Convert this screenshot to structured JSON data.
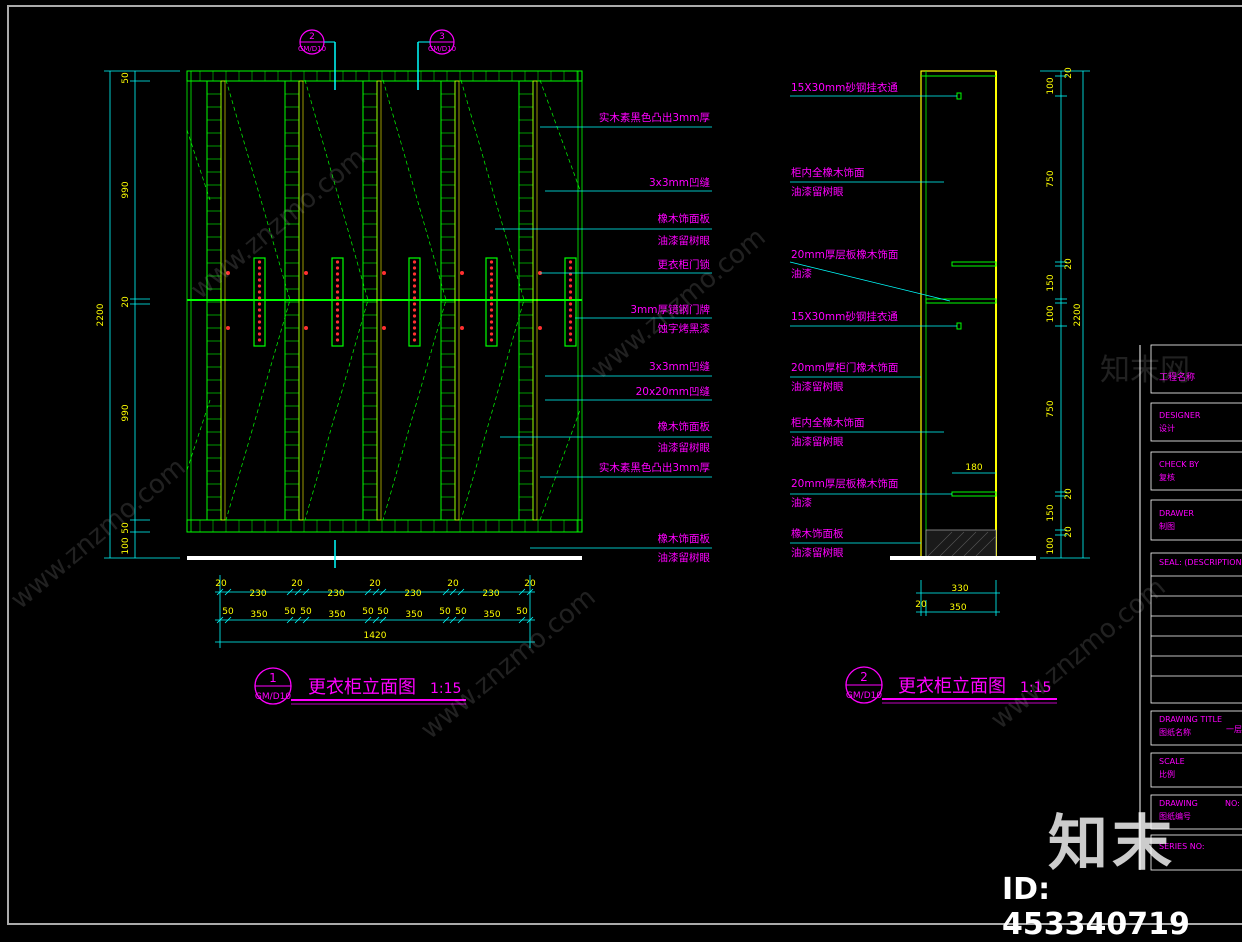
{
  "elevation_1": {
    "title": "更衣柜立面图",
    "scale": "1:15",
    "marker_num": "1",
    "marker_ref": "GM/D10",
    "section_markers": [
      {
        "num": "2",
        "ref": "GM/D10"
      },
      {
        "num": "3",
        "ref": "GM/D10"
      }
    ],
    "dims_left": [
      "50",
      "990",
      "20",
      "990",
      "50",
      "100"
    ],
    "dim_total": "2200",
    "dims_bottom_row1": [
      "20",
      "230",
      "20",
      "230",
      "20",
      "230",
      "20",
      "230",
      "20"
    ],
    "dims_bottom_row2": [
      "50",
      "350",
      "50",
      "50",
      "350",
      "50",
      "50",
      "350",
      "50",
      "50",
      "350",
      "50"
    ],
    "dim_width": "1420",
    "callouts": [
      [
        "实木素黑色凸出3mm厚"
      ],
      [
        "3x3mm凹缝"
      ],
      [
        "橡木饰面板",
        "油漆留树眼"
      ],
      [
        "更衣柜门锁"
      ],
      [
        "3mm厚镜钢门牌",
        "蚀字烤黑漆"
      ],
      [
        "3x3mm凹缝"
      ],
      [
        "20x20mm凹缝"
      ],
      [
        "橡木饰面板",
        "油漆留树眼"
      ],
      [
        "实木素黑色凸出3mm厚"
      ],
      [
        "橡木饰面板",
        "油漆留树眼"
      ]
    ]
  },
  "elevation_2": {
    "title": "更衣柜立面图",
    "scale": "1:15",
    "marker_num": "2",
    "marker_ref": "GM/D10",
    "callouts": [
      [
        "15X30mm砂钢挂衣通"
      ],
      [
        "柜内全橡木饰面",
        "油漆留树眼"
      ],
      [
        "20mm厚层板橡木饰面",
        "油漆"
      ],
      [
        "15X30mm砂钢挂衣通"
      ],
      [
        "20mm厚柜门橡木饰面",
        "油漆留树眼"
      ],
      [
        "柜内全橡木饰面",
        "油漆留树眼"
      ],
      [
        "20mm厚层板橡木饰面",
        "油漆"
      ],
      [
        "橡木饰面板",
        "油漆留树眼"
      ]
    ],
    "dim_shelf": "180",
    "dims_right": [
      "20",
      "100",
      "750",
      "20",
      "150",
      "100",
      "750",
      "20",
      "150",
      "20",
      "100"
    ],
    "dim_total": "2200",
    "dim_depth_1": "330",
    "dim_depth_2a": "20",
    "dim_depth_2b": "350"
  },
  "title_block": {
    "project": "工程名称",
    "designer_en": "DESIGNER",
    "designer_cn": "设计",
    "check_en": "CHECK BY",
    "check_cn": "复核",
    "drawer_en": "DRAWER",
    "drawer_cn": "制图",
    "seal": "SEAL: (DESCRIPTION)",
    "drawing_title_en": "DRAWING TITLE",
    "drawing_title_cn": "图纸名称",
    "drawing_title_val": "一层",
    "scale_en": "SCALE",
    "scale_cn": "比例",
    "drawing_no_en": "DRAWING",
    "drawing_no_suffix": "NO:",
    "drawing_no_cn": "图纸编号",
    "series": "SERIES NO:"
  },
  "watermark": {
    "brand": "知末",
    "id": "ID: 453340719",
    "site": "www.znzmo.com",
    "site_cn": "知末网"
  },
  "colors": {
    "background": "#000000",
    "green": "#00ff00",
    "yellow": "#ffff00",
    "cyan": "#00ffff",
    "magenta": "#ff00ff",
    "red": "#ff0000",
    "white": "#ffffff"
  }
}
